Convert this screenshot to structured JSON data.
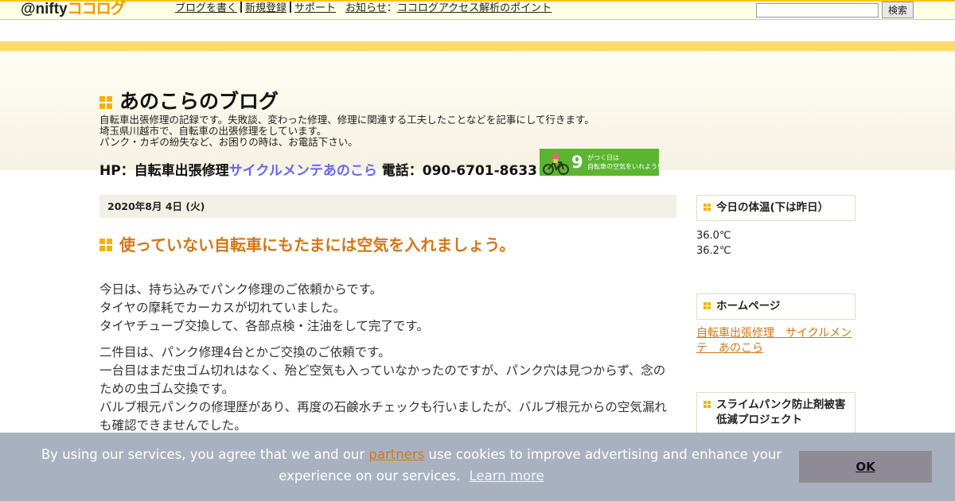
{
  "topbar": {
    "logo_nifty": "@nifty",
    "logo_cocolog": "ココログ",
    "nav": {
      "write_blog": "ブログを書く",
      "register": "新規登録",
      "support": "サポート",
      "news_label": "お知らせ",
      "news_colon": "：",
      "news_link": "ココログアクセス解析のポイント"
    },
    "search_value": "",
    "search_button": "検索"
  },
  "header": {
    "blog_title": "あのこらのブログ",
    "description": [
      "自転車出張修理の記録です。失敗談、変わった修理、修理に関連する工夫したことなどを記事にして行きます。",
      "埼玉県川越市で、自転車の出張修理をしています。",
      "パンク・カギの紛失など、お困りの時は、お電話下さい。"
    ],
    "hp_prefix": "HP：自転車出張修理",
    "hp_link": "サイクルメンテあのこら",
    "phone": "電話：090-6701-8633",
    "banner": {
      "number": "9",
      "text_line1": "がつく日は",
      "text_line2": "自転車の空気をいれよう!"
    }
  },
  "post": {
    "date": "2020年8月 4日 (火)",
    "title": "使っていない自転車にもたまには空気を入れましょう。",
    "paragraphs": [
      [
        "今日は、持ち込みでパンク修理のご依頼からです。",
        "タイヤの摩耗でカーカスが切れていました。",
        "タイヤチューブ交換して、各部点検・注油をして完了です。"
      ],
      [
        "二件目は、パンク修理4台とかご交換のご依頼です。",
        "一台目はまだ虫ゴム切れはなく、殆ど空気も入っていなかったのですが、パンク穴は見つからず、念のための虫ゴム交換です。",
        "バルブ根元パンクの修理歴があり、再度の石鹸水チェックも行いましたが、バルブ根元からの空気漏れも確認できませんでした。"
      ]
    ]
  },
  "sidebar": {
    "temperature": {
      "heading": "今日の体温(下は昨日）",
      "today": "36.0℃",
      "yesterday": "36.2℃"
    },
    "homepage": {
      "heading": "ホームページ",
      "link": "自転車出張修理　サイクルメンテ　あのこら"
    },
    "slime": {
      "heading": "スライムパンク防止剤被害低減プロジェクト"
    }
  },
  "cookie": {
    "text_before": "By using our services, you agree that we and our",
    "partners": "partners",
    "text_after": "use cookies to improve advertising and enhance your experience on our services.",
    "learn_more": "Learn more",
    "ok": "OK"
  },
  "colors": {
    "accent_orange": "#d47616",
    "link_blue": "#6666ee",
    "yellow_band": "#fedb6a",
    "cookie_bg": "#a9b1c0"
  }
}
